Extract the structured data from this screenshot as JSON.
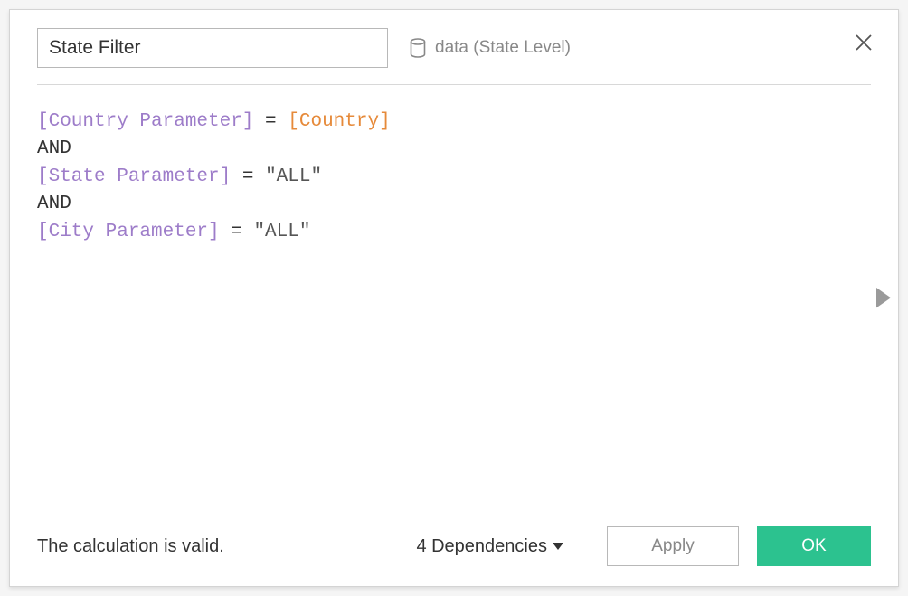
{
  "header": {
    "field_name": "State Filter",
    "data_source_label": "data (State Level)"
  },
  "formula": {
    "line1_param": "[Country Parameter]",
    "line1_op": " = ",
    "line1_field": "[Country]",
    "line2_kw": "AND",
    "line3_param": "[State Parameter]",
    "line3_op": " = ",
    "line3_str": "\"ALL\"",
    "line4_kw": "AND",
    "line5_param": "[City Parameter]",
    "line5_op": " = ",
    "line5_str": "\"ALL\""
  },
  "footer": {
    "status": "The calculation is valid.",
    "dependencies_label": "4 Dependencies",
    "apply_label": "Apply",
    "ok_label": "OK"
  }
}
